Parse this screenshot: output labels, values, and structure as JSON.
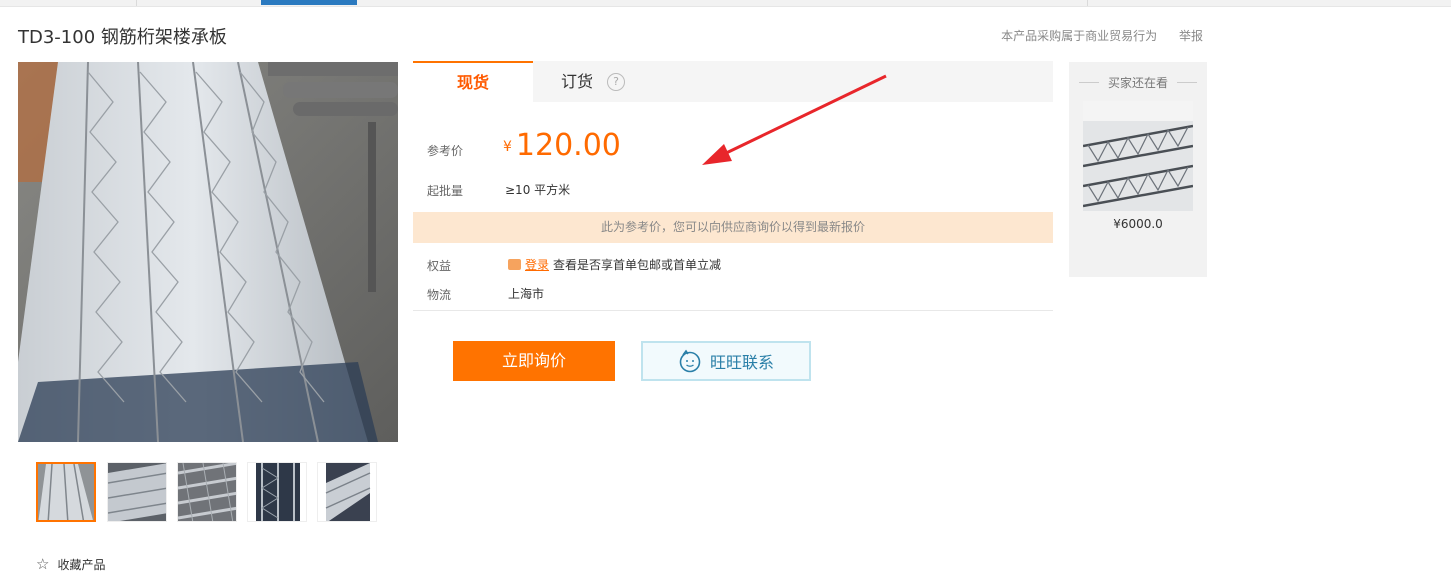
{
  "product": {
    "title": "TD3-100 钢筋桁架楼承板"
  },
  "top_links": {
    "trade_notice": "本产品采购属于商业贸易行为",
    "report": "举报"
  },
  "tabs": {
    "spot": "现货",
    "order": "订货",
    "help": "?"
  },
  "pricing": {
    "reference_label": "参考价",
    "currency": "¥",
    "price": "120.00",
    "moq_label": "起批量",
    "moq_value": "≥10  平方米",
    "notice": "此为参考价，您可以向供应商询价以得到最新报价"
  },
  "benefits": {
    "label": "权益",
    "login_link": "登录",
    "text": "查看是否享首单包邮或首单立减"
  },
  "logistics": {
    "label": "物流",
    "value": "上海市"
  },
  "buttons": {
    "inquire": "立即询价",
    "wangwang": "旺旺联系"
  },
  "gallery": {
    "favorite": "收藏产品",
    "thumbnail_count": 5,
    "active_thumbnail": 1
  },
  "side_panel": {
    "title": "买家还在看",
    "price": "¥6000.0"
  },
  "colors": {
    "accent_orange": "#ff7300",
    "price_orange": "#ff6a00",
    "notice_bg": "#fde7d0",
    "annotation_arrow": "#e8262b"
  }
}
